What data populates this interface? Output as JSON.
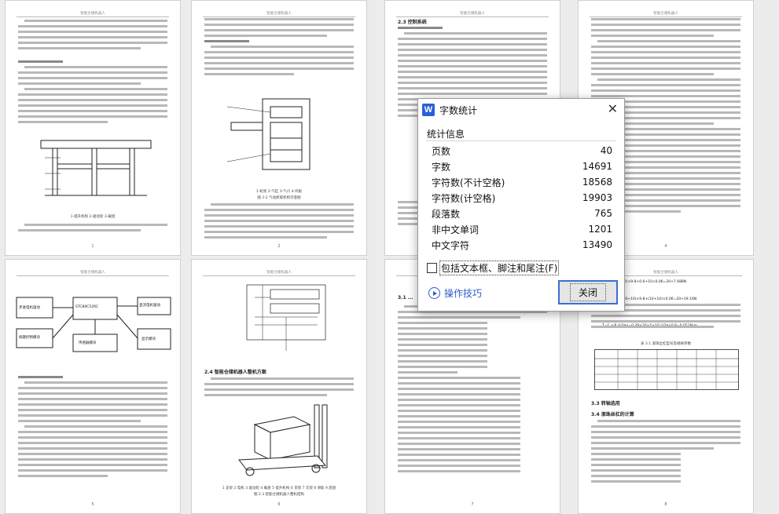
{
  "document": {
    "header_text": "智能仓储机器人",
    "section_23": "2.3 控制系统",
    "section_24": "2.4 智能仓储机器人整机方案",
    "section_31": "3.1 ...",
    "section_33": "3.3 转轴选用",
    "section_34": "3.4 滚珠丝杠的计算",
    "table_title": "表 3.1 滚珠丝杠型号及规格参数",
    "fig_caption_24": "图 2.3 智能仓储机器人整机结构",
    "fig_caption_24_parts": "1 支架 2 电机 3 驱动轮 4 载盘 5 提升机构 6 货架 7 叉架 8 滑轨 9 底盘",
    "formula_1": "=(10+10)×9.8+0.6+10×0.06=20+7.688N",
    "formula_2": "=0.2×(10+10)×9.8+(10+10)×0.06=20+19.16N",
    "formula_3": "T=F_a·P_h/2πη=0.29×20×5×10⁻³/2π×0.9=0.051N·m",
    "block_main": "STC89C52RC",
    "block_left": "步进电机驱动",
    "block_right": "直流电机驱动",
    "block_top": "传感器模块",
    "block_btm_left": "按键控制模块",
    "block_btm_right": "显示模块",
    "page_numbers": [
      "1",
      "2",
      "3",
      "4",
      "5",
      "6",
      "7",
      "8"
    ]
  },
  "dialog": {
    "app_icon": "W",
    "title": "字数统计",
    "section_label": "统计信息",
    "stats": [
      {
        "label": "页数",
        "value": "40"
      },
      {
        "label": "字数",
        "value": "14691"
      },
      {
        "label": "字符数(不计空格)",
        "value": "18568"
      },
      {
        "label": "字符数(计空格)",
        "value": "19903"
      },
      {
        "label": "段落数",
        "value": "765"
      },
      {
        "label": "非中文单词",
        "value": "1201"
      },
      {
        "label": "中文字符",
        "value": "13490"
      }
    ],
    "checkbox_label": "包括文本框、脚注和尾注(F)",
    "checkbox_checked": false,
    "tips_label": "操作技巧",
    "close_button": "关闭",
    "accent_color": "#2f5dc6"
  }
}
